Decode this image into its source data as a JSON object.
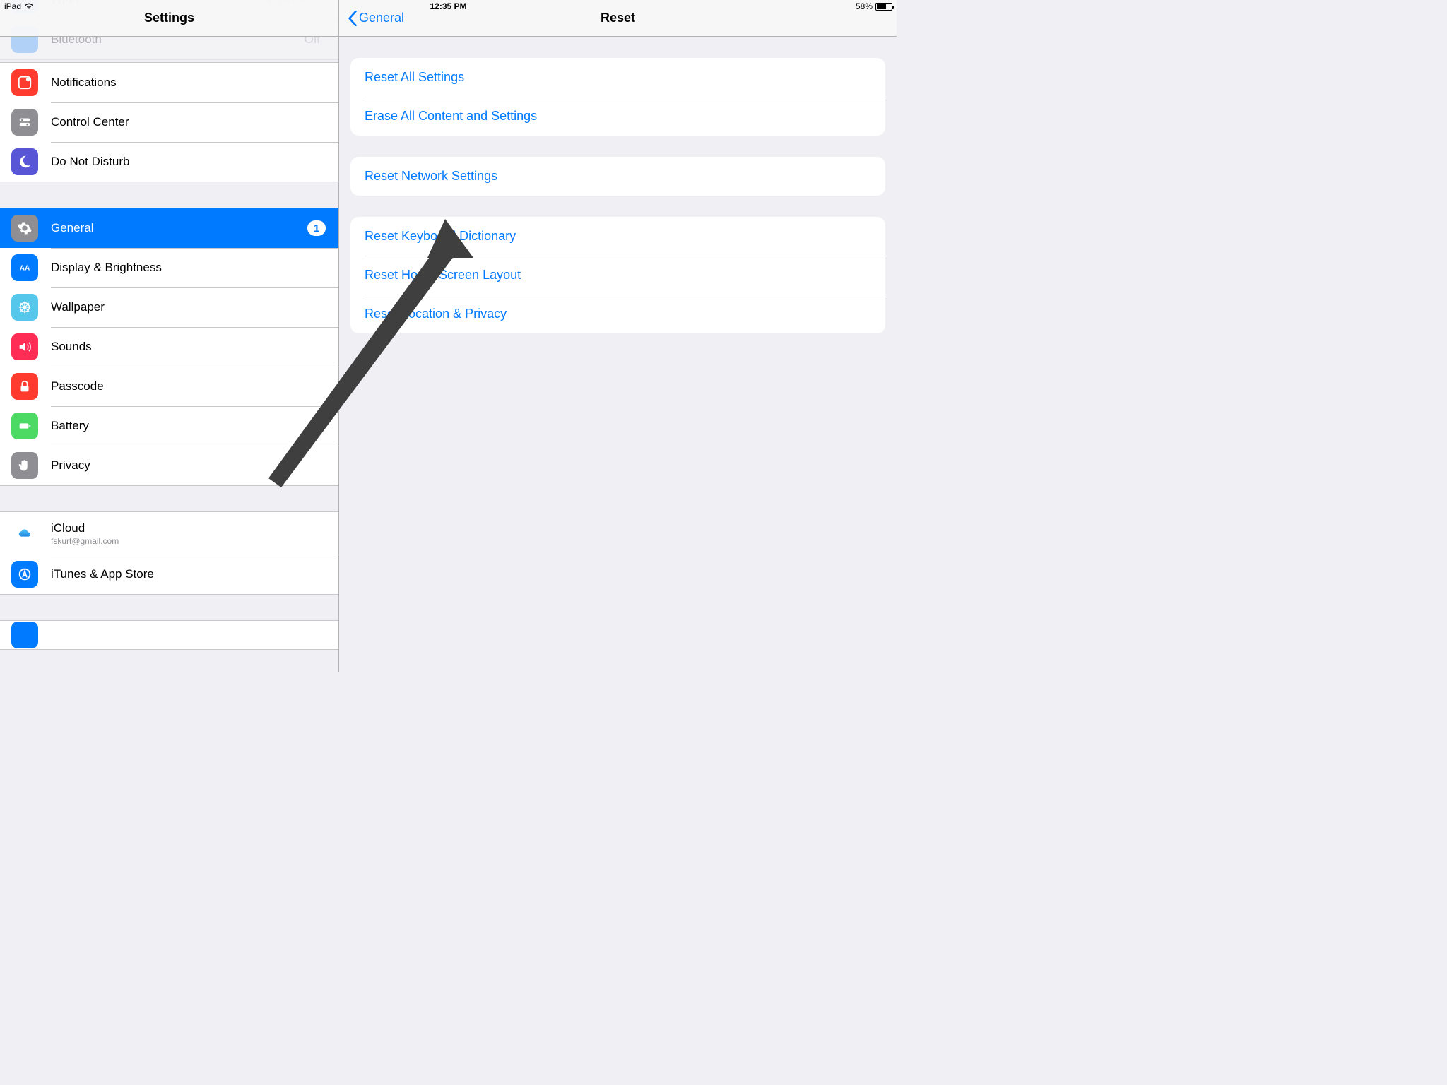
{
  "statusbar": {
    "device": "iPad",
    "time": "12:35 PM",
    "battery_pct": "58%",
    "battery_fill": 58
  },
  "sidebar": {
    "title": "Settings",
    "ghost": {
      "wifi_label": "Wi-Fi",
      "wifi_value": "superhero",
      "bt_label": "Bluetooth",
      "bt_value": "Off"
    },
    "group1": [
      {
        "label": "Notifications"
      },
      {
        "label": "Control Center"
      },
      {
        "label": "Do Not Disturb"
      }
    ],
    "group2": [
      {
        "label": "General",
        "badge": "1"
      },
      {
        "label": "Display & Brightness"
      },
      {
        "label": "Wallpaper"
      },
      {
        "label": "Sounds"
      },
      {
        "label": "Passcode"
      },
      {
        "label": "Battery"
      },
      {
        "label": "Privacy"
      }
    ],
    "group3": [
      {
        "label": "iCloud",
        "subtitle": "fskurt@gmail.com"
      },
      {
        "label": "iTunes & App Store"
      }
    ]
  },
  "detail": {
    "back": "General",
    "title": "Reset",
    "section1": [
      "Reset All Settings",
      "Erase All Content and Settings"
    ],
    "section2": [
      "Reset Network Settings"
    ],
    "section3": [
      "Reset Keyboard Dictionary",
      "Reset Home Screen Layout",
      "Reset Location & Privacy"
    ]
  }
}
